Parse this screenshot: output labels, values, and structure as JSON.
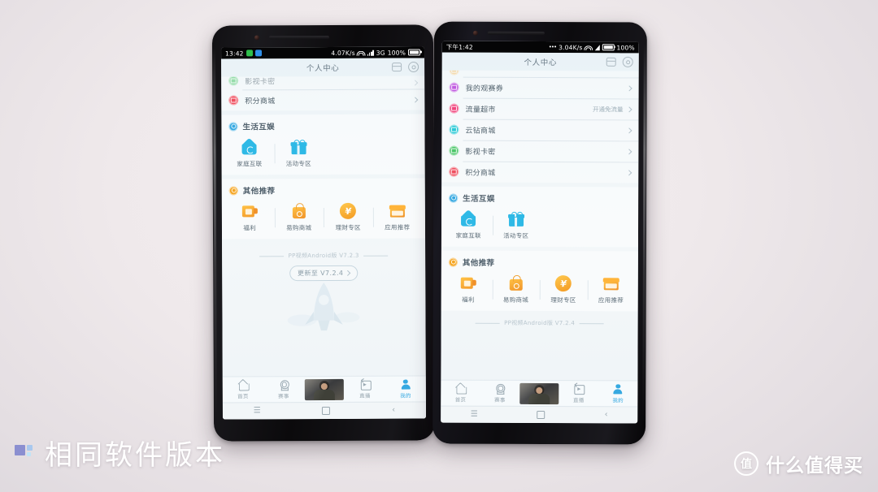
{
  "background": {
    "color_top": "#f4eef0",
    "color_bottom": "#d6d2d8"
  },
  "phones": [
    {
      "id": "left",
      "status_bar": {
        "time": "13:42",
        "speed": "4.07K/s",
        "network": "3G",
        "battery": "100%",
        "wifi_icon": "wifi-icon",
        "signal_icon": "signal-bars-icon",
        "battery_icon": "battery-full-icon",
        "notif_icons": [
          "green-app-icon",
          "blue-app-icon"
        ]
      },
      "app_header": {
        "title": "个人中心",
        "icons": [
          "message-list-icon",
          "gear-icon"
        ]
      },
      "list_rows": [
        {
          "label": "影视卡密",
          "color": "#4cc76a",
          "right_text": "",
          "partial": true
        },
        {
          "label": "积分商城",
          "color": "#ef5060",
          "right_text": ""
        }
      ],
      "sections": [
        {
          "title": "生活互娱",
          "icon_color": "#36a9e1",
          "items": [
            {
              "label": "家庭互联",
              "icon": "home-sync-icon"
            },
            {
              "label": "活动专区",
              "icon": "gift-icon"
            }
          ]
        },
        {
          "title": "其他推荐",
          "icon_color": "#f5a623",
          "items": [
            {
              "label": "福利",
              "icon": "wallet-icon"
            },
            {
              "label": "易购商城",
              "icon": "shopping-bag-icon"
            },
            {
              "label": "理财专区",
              "icon": "yen-coin-icon"
            },
            {
              "label": "应用推荐",
              "icon": "shop-icon"
            }
          ]
        }
      ],
      "version": {
        "text": "PP视频Android版 V7.2.3",
        "update_button": "更新至 V7.2.4",
        "update_chevron": "chevron-right-icon",
        "has_update": true
      },
      "tabs": [
        {
          "label": "首页",
          "icon": "home-icon",
          "active": false
        },
        {
          "label": "赛事",
          "icon": "medal-icon",
          "active": false
        },
        {
          "label": "",
          "icon": "video-thumbnail",
          "active": false,
          "is_thumb": true
        },
        {
          "label": "直播",
          "icon": "live-icon",
          "active": false
        },
        {
          "label": "我的",
          "icon": "person-icon",
          "active": true
        }
      ],
      "nav_bar": [
        "recents-icon",
        "home-square-icon",
        "back-icon"
      ]
    },
    {
      "id": "right",
      "status_bar": {
        "time": "下午1:42",
        "speed": "3.04K/s",
        "network": "",
        "battery": "100%",
        "wifi_icon": "wifi-icon",
        "signal_icon": "signal-triangle-icon",
        "battery_icon": "battery-full-icon",
        "notif_icons": []
      },
      "app_header": {
        "title": "个人中心",
        "icons": [
          "message-list-icon",
          "gear-icon"
        ]
      },
      "list_rows": [
        {
          "label": "我的观赛券",
          "color": "#c05ce0",
          "right_text": ""
        },
        {
          "label": "流量超市",
          "color": "#f0467e",
          "right_text": "开通免流量"
        },
        {
          "label": "云钻商城",
          "color": "#2bc9d6",
          "right_text": ""
        },
        {
          "label": "影视卡密",
          "color": "#4cc76a",
          "right_text": ""
        },
        {
          "label": "积分商城",
          "color": "#ef5060",
          "right_text": ""
        }
      ],
      "sections": [
        {
          "title": "生活互娱",
          "icon_color": "#36a9e1",
          "items": [
            {
              "label": "家庭互联",
              "icon": "home-sync-icon"
            },
            {
              "label": "活动专区",
              "icon": "gift-icon"
            }
          ]
        },
        {
          "title": "其他推荐",
          "icon_color": "#f5a623",
          "items": [
            {
              "label": "福利",
              "icon": "wallet-icon"
            },
            {
              "label": "易购商城",
              "icon": "shopping-bag-icon"
            },
            {
              "label": "理财专区",
              "icon": "yen-coin-icon"
            },
            {
              "label": "应用推荐",
              "icon": "shop-icon"
            }
          ]
        }
      ],
      "version": {
        "text": "PP视频Android版 V7.2.4",
        "update_button": "",
        "update_chevron": "",
        "has_update": false
      },
      "tabs": [
        {
          "label": "首页",
          "icon": "home-icon",
          "active": false
        },
        {
          "label": "赛事",
          "icon": "medal-icon",
          "active": false
        },
        {
          "label": "",
          "icon": "video-thumbnail",
          "active": false,
          "is_thumb": true
        },
        {
          "label": "直播",
          "icon": "live-icon",
          "active": false
        },
        {
          "label": "我的",
          "icon": "person-icon",
          "active": true
        }
      ],
      "nav_bar": [
        "recents-icon",
        "home-square-icon",
        "back-icon"
      ]
    }
  ],
  "watermarks": {
    "left_caption": "相同软件版本",
    "left_logo": "three-squares-logo",
    "right_badge_char": "值",
    "right_text": "什么值得买"
  }
}
